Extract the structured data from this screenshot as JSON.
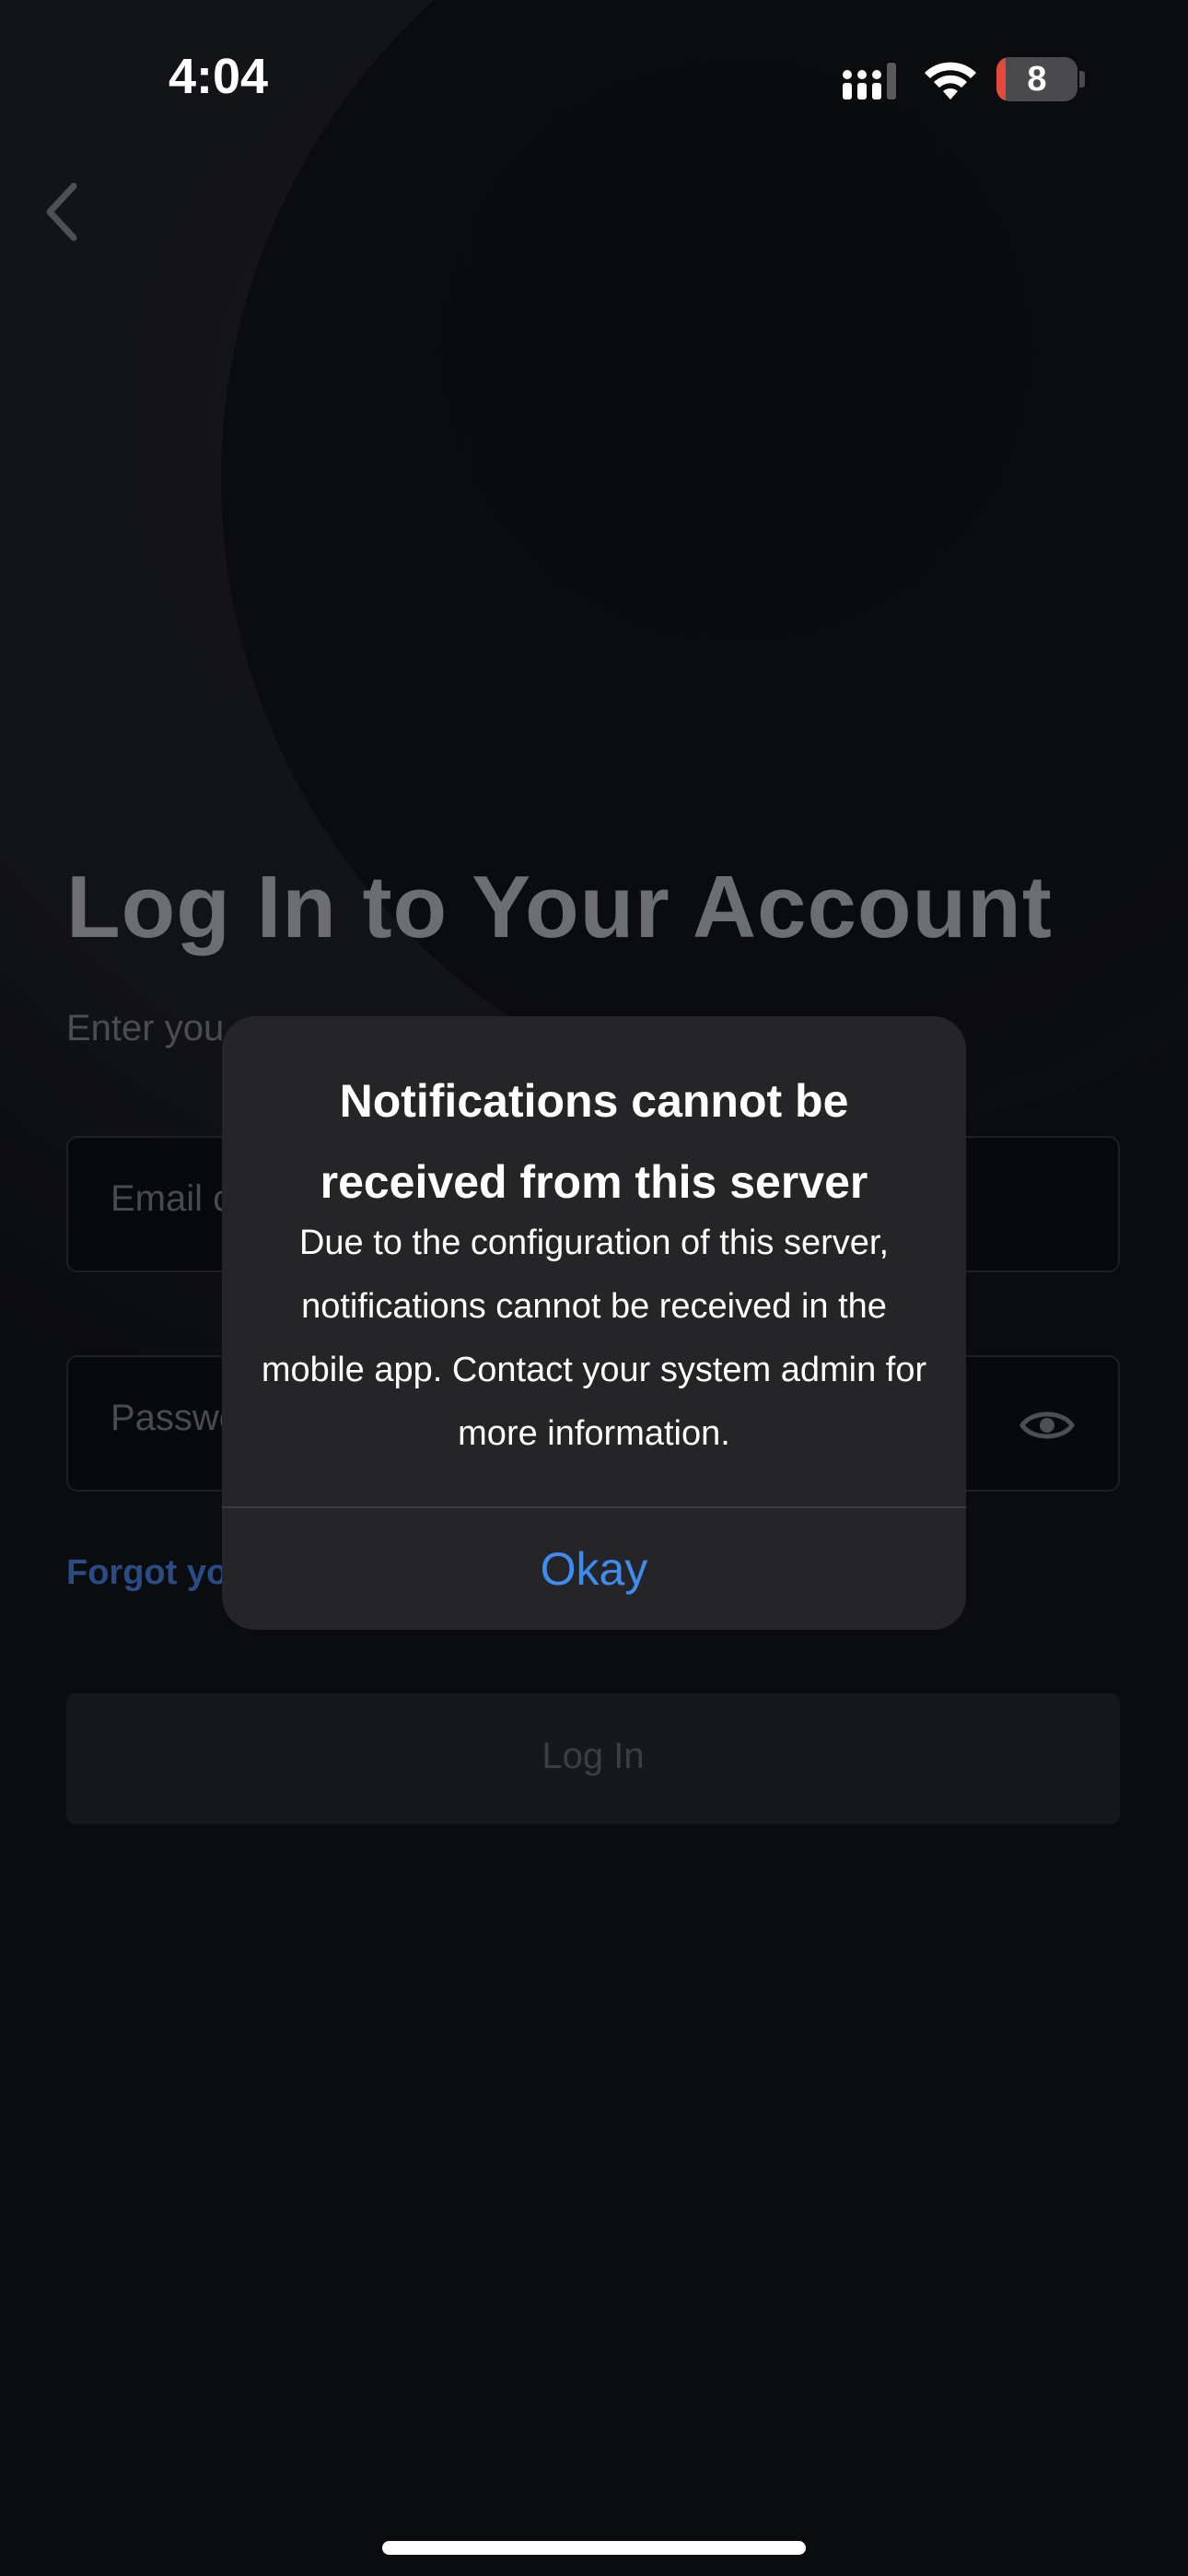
{
  "status_bar": {
    "time": "4:04",
    "battery_level": "8",
    "signal_icon": "cellular-signal-icon",
    "wifi_icon": "wifi-icon",
    "battery_color": "#e5483d"
  },
  "nav": {
    "back_icon": "chevron-left-icon"
  },
  "login": {
    "title": "Log In to Your Account",
    "subtitle": "Enter you",
    "email_placeholder": "Email c",
    "password_placeholder": "Passwc",
    "password_toggle_icon": "eye-icon",
    "forgot_link": "Forgot you",
    "login_button": "Log In"
  },
  "alert": {
    "title": "Notifications cannot be received from this server",
    "message": "Due to the configuration of this server, notifications cannot be received in the mobile app. Contact your system admin for more information.",
    "button": "Okay",
    "button_color": "#3f8cf0"
  }
}
